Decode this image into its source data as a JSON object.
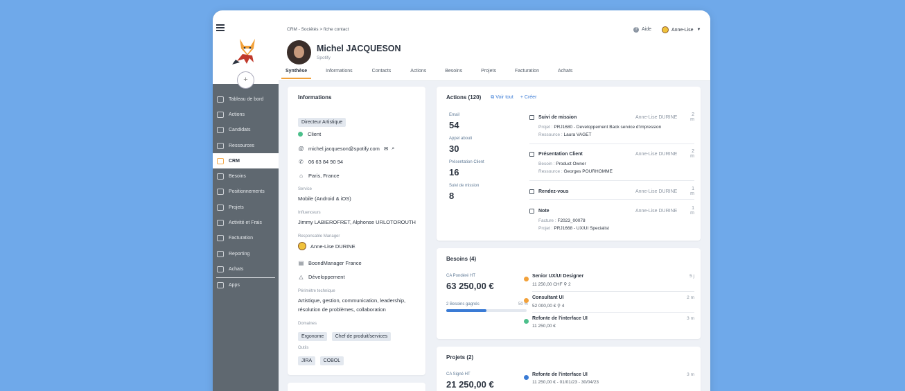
{
  "sidebar": {
    "add_label": "+",
    "items": [
      {
        "label": "Tableau de bord"
      },
      {
        "label": "Actions"
      },
      {
        "label": "Candidats"
      },
      {
        "label": "Ressources"
      },
      {
        "label": "CRM"
      },
      {
        "label": "Besoins"
      },
      {
        "label": "Positionnements"
      },
      {
        "label": "Projets"
      },
      {
        "label": "Activité et Frais"
      },
      {
        "label": "Facturation"
      },
      {
        "label": "Reporting"
      },
      {
        "label": "Achats"
      },
      {
        "label": "Apps"
      }
    ],
    "active": "CRM"
  },
  "header": {
    "breadcrumb": "CRM - Sociétés > fiche contact",
    "help": "Aide",
    "user": "Anne-Lise",
    "contact_name": "Michel JACQUESON",
    "company": "Spotify",
    "plus": "+",
    "tabs": [
      "Synthèse",
      "Informations",
      "Contacts",
      "Actions",
      "Besoins",
      "Projets",
      "Facturation",
      "Achats"
    ]
  },
  "info": {
    "title": "Informations",
    "role": "Directeur Artistique",
    "status": "Client",
    "email": "michel.jacqueson@spotify.com",
    "phone": "06 63 84 90 94",
    "location": "Paris, France",
    "service_label": "Service",
    "service": "Mobile (Android & iOS)",
    "influencers_label": "Influenceurs",
    "influencers": "Jimmy LABIEROFRET, Alphonse URLOTOROUTH",
    "manager_label": "Responsable Manager",
    "manager": "Anne-Lise DURINE",
    "agency": "BoondManager France",
    "pole": "Développement",
    "perimeter_label": "Périmètre technique",
    "perimeter_1": "Artistique, gestion, communication, leadership,",
    "perimeter_2": "résolution de problèmes, collaboration",
    "domains_label": "Domaines",
    "domains": [
      "Ergonome",
      "Chef de produit/services"
    ],
    "tools_label": "Outils",
    "tools": [
      "JIRA",
      "COBOL"
    ]
  },
  "actions": {
    "title": "Actions (120)",
    "view_all": "Voir tout",
    "create": "+ Créer",
    "stats": [
      {
        "label": "Email",
        "value": "54"
      },
      {
        "label": "Appel abouti",
        "value": "30"
      },
      {
        "label": "Présentation Client",
        "value": "16"
      },
      {
        "label": "Suivi de mission",
        "value": "8"
      }
    ],
    "list": [
      {
        "title": "Suivi de mission",
        "who": "Anne-Lise DURINE",
        "ago": "2 m",
        "sub1_k": "Projet : ",
        "sub1_v": "PRJ1680 - Developpement Back service d'impression",
        "sub2_k": "Ressource : ",
        "sub2_v": "Laura VAGET"
      },
      {
        "title": "Présentation Client",
        "who": "Anne-Lise DURINE",
        "ago": "2 m",
        "sub1_k": "Besoin : ",
        "sub1_v": "Product Owner",
        "sub2_k": "Ressource : ",
        "sub2_v": "Georges POURHOMME"
      },
      {
        "title": "Rendez-vous",
        "who": "Anne-Lise DURINE",
        "ago": "1 m"
      },
      {
        "title": "Note",
        "who": "Anne-Lise DURINE",
        "ago": "1 m",
        "sub1_k": "Facture : ",
        "sub1_v": "F2023_00078",
        "sub2_k": "Projet : ",
        "sub2_v": "PRJ1668 - UX/UI Specialist"
      }
    ]
  },
  "besoins": {
    "title": "Besoins (4)",
    "ca_label": "CA Pondéré HT",
    "ca_value": "63 250,00 €",
    "won_label": "2 Besoins gagnés",
    "won_pct": "50 %",
    "won_fraction": 0.5,
    "items": [
      {
        "title": "Senior UX/UI Designer",
        "detail": "11 250,00 CHF  ⚲  2",
        "ago": "5 j",
        "color": "#f2a13a"
      },
      {
        "title": "Consultant UI",
        "detail": "52 000,00 €  ⚲  4",
        "ago": "2 m",
        "color": "#f2a13a"
      },
      {
        "title": "Refonte de l'interface UI",
        "detail": "11 250,00 €",
        "ago": "3 m",
        "color": "#4cbf8b"
      }
    ]
  },
  "projets": {
    "title": "Projets (2)",
    "ca_label": "CA Signé HT",
    "ca_value": "21 250,00 €",
    "items": [
      {
        "title": "Refonte de l'interface UI",
        "detail": "11 250,00 € - 01/01/23 - 30/04/23",
        "ago": "3 m",
        "color": "#3a7bd5"
      }
    ]
  },
  "colors": {
    "accent": "#f2a13a",
    "sidebar": "#5f6870",
    "link": "#3a7bd5",
    "client_status": "#4cbf8b",
    "background": "#6fa9ea"
  },
  "icons": [
    "menu-icon",
    "fox-logo-icon",
    "help-icon",
    "chat-icon",
    "mail-icon",
    "search-icon",
    "phone-icon",
    "home-icon",
    "calendar-icon"
  ]
}
